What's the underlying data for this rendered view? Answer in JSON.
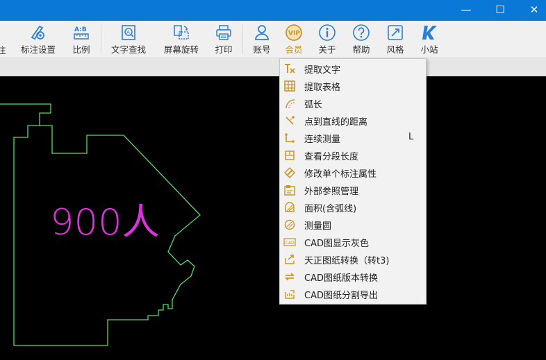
{
  "window": {
    "minimize_glyph": "—",
    "maximize_glyph": "☐",
    "close_glyph": "✕",
    "titlebar_color": "#0a78d7"
  },
  "toolbar": {
    "partial_label": "注",
    "items": [
      {
        "label": "标注设置",
        "icon": "gear-annotation-icon"
      },
      {
        "label": "比例",
        "icon": "ruler-ratio-icon"
      },
      {
        "label": "文字查找",
        "icon": "text-search-icon"
      },
      {
        "label": "屏幕旋转",
        "icon": "screen-rotate-icon"
      },
      {
        "label": "打印",
        "icon": "printer-icon"
      },
      {
        "label": "账号",
        "icon": "user-icon"
      },
      {
        "label": "会员",
        "icon": "vip-icon"
      },
      {
        "label": "关于",
        "icon": "info-icon"
      },
      {
        "label": "帮助",
        "icon": "help-icon"
      },
      {
        "label": "风格",
        "icon": "style-icon"
      },
      {
        "label": "小站",
        "icon": "site-k-icon"
      }
    ],
    "accent_color": "#2a7fd4",
    "vip_color": "#c9962b"
  },
  "drawing": {
    "text": "900人",
    "line_color": "#55dd66",
    "text_color": "#dd33dd"
  },
  "menu": {
    "items": [
      {
        "label": "提取文字",
        "icon": "extract-text-icon",
        "shortcut": ""
      },
      {
        "label": "提取表格",
        "icon": "extract-table-icon",
        "shortcut": ""
      },
      {
        "label": "弧长",
        "icon": "arc-length-icon",
        "shortcut": ""
      },
      {
        "label": "点到直线的距离",
        "icon": "point-line-distance-icon",
        "shortcut": ""
      },
      {
        "label": "连续测量",
        "icon": "continuous-measure-icon",
        "shortcut": "L"
      },
      {
        "label": "查看分段长度",
        "icon": "segment-length-icon",
        "shortcut": ""
      },
      {
        "label": "修改单个标注属性",
        "icon": "edit-annotation-icon",
        "shortcut": ""
      },
      {
        "label": "外部参照管理",
        "icon": "xref-manage-icon",
        "shortcut": ""
      },
      {
        "label": "面积(含弧线)",
        "icon": "area-arc-icon",
        "shortcut": ""
      },
      {
        "label": "测量圆",
        "icon": "measure-circle-icon",
        "shortcut": ""
      },
      {
        "label": "CAD图显示灰色",
        "icon": "cad-gray-icon",
        "shortcut": ""
      },
      {
        "label": "天正图纸转换（转t3)",
        "icon": "tangent-convert-icon",
        "shortcut": ""
      },
      {
        "label": "CAD图纸版本转换",
        "icon": "version-convert-icon",
        "shortcut": ""
      },
      {
        "label": "CAD图纸分割导出",
        "icon": "split-export-icon",
        "shortcut": ""
      }
    ],
    "cad_badge": "CAD",
    "icon_color": "#c9962b"
  }
}
